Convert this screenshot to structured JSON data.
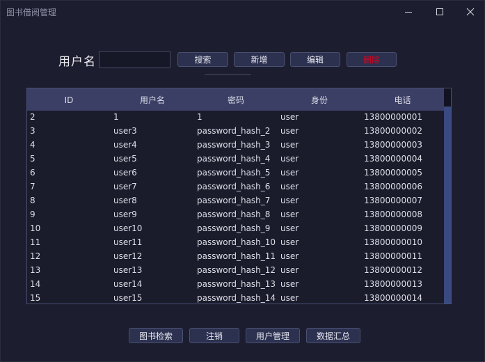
{
  "window": {
    "title": "图书借阅管理"
  },
  "toolbar": {
    "search_label": "用户名",
    "search_value": "",
    "search_button": "搜索",
    "add_button": "新增",
    "edit_button": "编辑",
    "delete_button": "删除",
    "delete_color": "#e0001b"
  },
  "table": {
    "columns": [
      "ID",
      "用户名",
      "密码",
      "身份",
      "电话"
    ],
    "rows": [
      [
        "2",
        "1",
        "1",
        "user",
        "13800000001"
      ],
      [
        "3",
        "user3",
        "password_hash_2",
        "user",
        "13800000002"
      ],
      [
        "4",
        "user4",
        "password_hash_3",
        "user",
        "13800000003"
      ],
      [
        "5",
        "user5",
        "password_hash_4",
        "user",
        "13800000004"
      ],
      [
        "6",
        "user6",
        "password_hash_5",
        "user",
        "13800000005"
      ],
      [
        "7",
        "user7",
        "password_hash_6",
        "user",
        "13800000006"
      ],
      [
        "8",
        "user8",
        "password_hash_7",
        "user",
        "13800000007"
      ],
      [
        "9",
        "user9",
        "password_hash_8",
        "user",
        "13800000008"
      ],
      [
        "10",
        "user10",
        "password_hash_9",
        "user",
        "13800000009"
      ],
      [
        "11",
        "user11",
        "password_hash_10",
        "user",
        "13800000010"
      ],
      [
        "12",
        "user12",
        "password_hash_11",
        "user",
        "13800000011"
      ],
      [
        "13",
        "user13",
        "password_hash_12",
        "user",
        "13800000012"
      ],
      [
        "14",
        "user14",
        "password_hash_13",
        "user",
        "13800000013"
      ],
      [
        "15",
        "user15",
        "password_hash_14",
        "user",
        "13800000014"
      ]
    ]
  },
  "bottom_nav": {
    "books_button": "图书检索",
    "logout_button": "注销",
    "users_button": "用户管理",
    "stats_button": "数据汇总"
  },
  "colors": {
    "background": "#1c1d2e",
    "header": "#3b3f66",
    "button": "#2c3150",
    "scrollbar": "#3a4a80"
  },
  "icons": {
    "minimize": "minimize-icon",
    "maximize": "maximize-icon",
    "close": "close-icon"
  }
}
